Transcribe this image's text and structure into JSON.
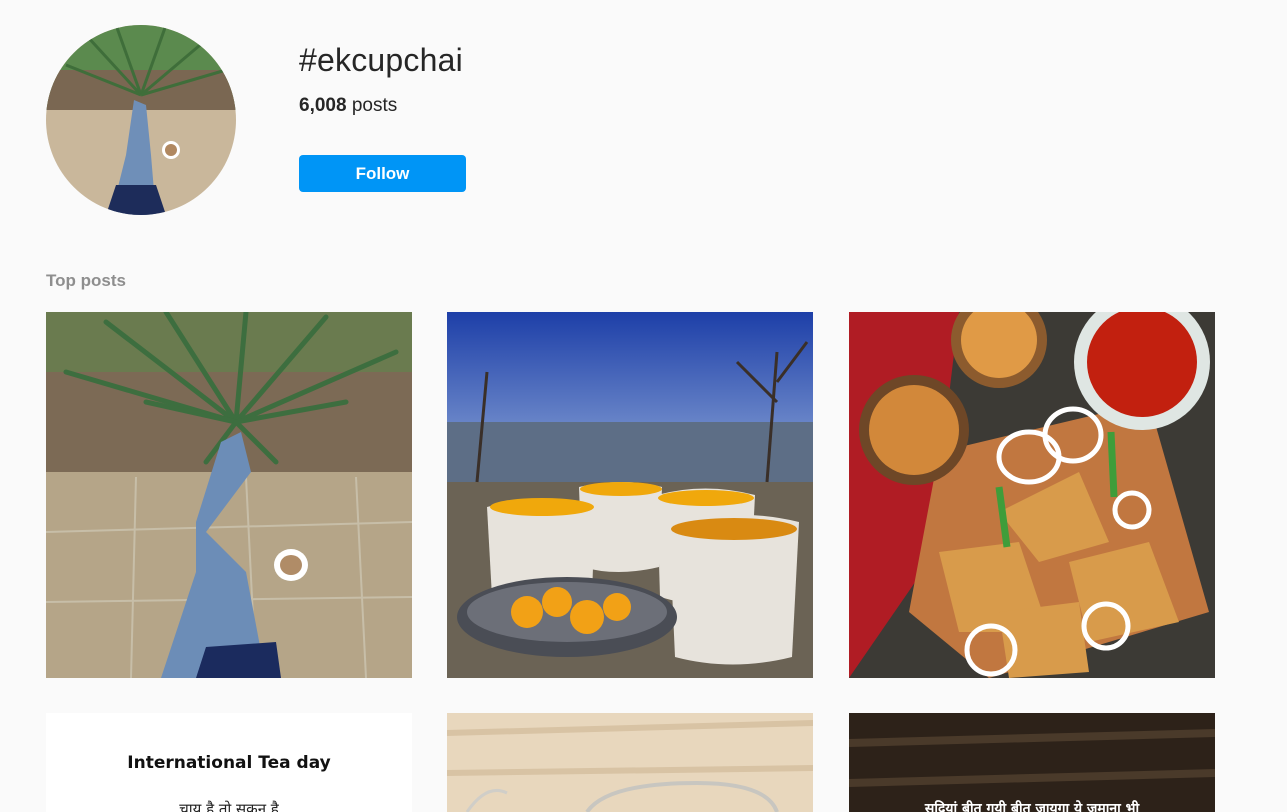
{
  "header": {
    "hashtag": "#ekcupchai",
    "post_count": "6,008",
    "post_suffix": " posts",
    "follow_label": "Follow"
  },
  "sections": {
    "top_posts_label": "Top posts"
  },
  "posts": [
    {
      "subject": "feet by plants with tea cup"
    },
    {
      "subject": "tea cups with mountain view"
    },
    {
      "subject": "samosa with chai and chutney"
    },
    {
      "title": "International Tea day",
      "line": "चाय है तो सुकून है"
    },
    {
      "subject": "glass cup on wooden table"
    },
    {
      "line": "सदियां बीत गयी बीत जायगा ये जमाना भी"
    }
  ],
  "colors": {
    "follow_button": "#0095f6",
    "background": "#fafafa",
    "muted_text": "#8e8e8e"
  }
}
